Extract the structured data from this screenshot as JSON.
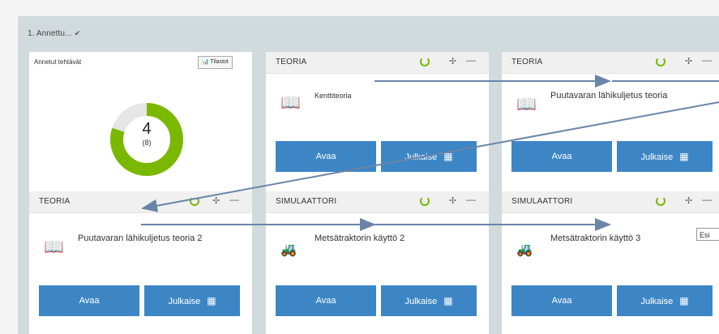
{
  "panel_title": "1. Annettu...",
  "stats_card": {
    "title": "Annetut tehtävät",
    "button_label": "Tilastot",
    "count": "4",
    "sub": "(8)"
  },
  "cards": [
    {
      "type": "TEORIA",
      "title": "Kenttiteoria",
      "open": "Avaa",
      "publish": "Julkaise"
    },
    {
      "type": "TEORIA",
      "title": "Puutavaran lähikuljetus teoria",
      "open": "Avaa",
      "publish": "Julkaise"
    },
    {
      "type": "TEORIA",
      "title": "Puutavaran lähikuljetus teoria 2",
      "open": "Avaa",
      "publish": "Julkaise"
    },
    {
      "type": "SIMULAATTORI",
      "title": "Metsätraktorin käyttö 2",
      "open": "Avaa",
      "publish": "Julkaise"
    },
    {
      "type": "SIMULAATTORI",
      "title": "Metsätraktorin käyttö 3",
      "open": "Avaa",
      "publish": "Julkaise"
    }
  ],
  "partial_button": "Esi",
  "colors": {
    "accent": "#3d86c6",
    "donut": "#7ab800",
    "panel": "#d1dadd",
    "arrow": "#6a85a8"
  }
}
